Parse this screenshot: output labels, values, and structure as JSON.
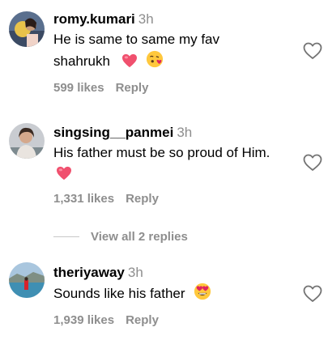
{
  "comments": [
    {
      "username": "romy.kumari",
      "time": "3h",
      "text_line1": "He is same to same my fav",
      "text_line2": "shahrukh",
      "emojis": [
        "pink-heart-emoji",
        "face-blowing-kiss-emoji"
      ],
      "likes": "599 likes",
      "reply": "Reply"
    },
    {
      "username": "singsing__panmei",
      "time": "3h",
      "text_line1": "His father must be so proud of Him.",
      "emojis": [
        "pink-heart-emoji"
      ],
      "likes": "1,331 likes",
      "reply": "Reply",
      "view_replies": "View all 2 replies"
    },
    {
      "username": "theriyaway",
      "time": "3h",
      "text_line1": "Sounds like his father",
      "emojis": [
        "heart-eyes-emoji"
      ],
      "likes": "1,939 likes",
      "reply": "Reply"
    }
  ],
  "colors": {
    "text": "#000000",
    "secondary": "#8e8e8e",
    "heart_emoji": "#f0506e"
  }
}
